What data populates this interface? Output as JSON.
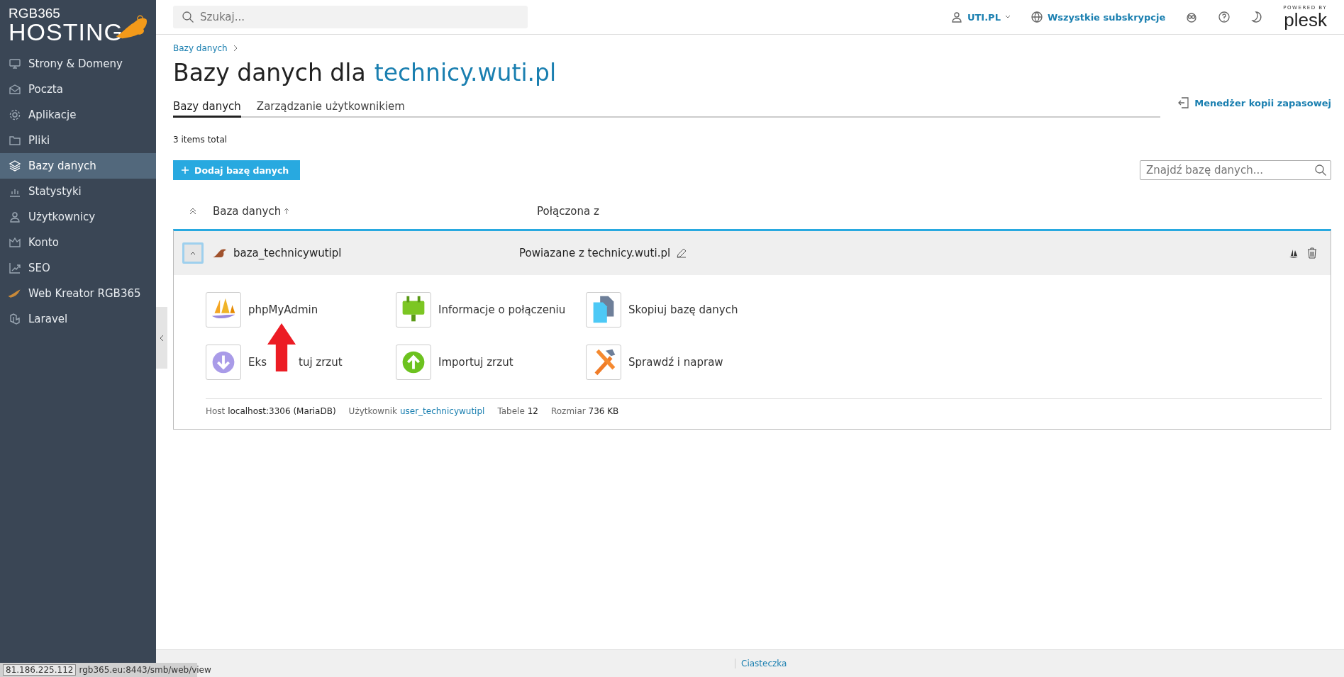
{
  "sidebar": {
    "logo": {
      "line1": "RGB365",
      "line2": "HOSTING"
    },
    "items": [
      {
        "label": "Strony & Domeny",
        "selected": false
      },
      {
        "label": "Poczta",
        "selected": false
      },
      {
        "label": "Aplikacje",
        "selected": false
      },
      {
        "label": "Pliki",
        "selected": false
      },
      {
        "label": "Bazy danych",
        "selected": true
      },
      {
        "label": "Statystyki",
        "selected": false
      },
      {
        "label": "Użytkownicy",
        "selected": false
      },
      {
        "label": "Konto",
        "selected": false
      },
      {
        "label": "SEO",
        "selected": false
      },
      {
        "label": "Web Kreator RGB365",
        "selected": false
      },
      {
        "label": "Laravel",
        "selected": false
      }
    ]
  },
  "topbar": {
    "search": {
      "placeholder": "Szukaj..."
    },
    "user": "UTI.PL",
    "subscriptions": "Wszystkie subskrypcje",
    "powered_by": "POWERED BY",
    "brand": "plesk"
  },
  "breadcrumb": [
    "Bazy danych"
  ],
  "title": {
    "text": "Bazy danych dla",
    "domain": "technicy.wuti.pl"
  },
  "tabs": [
    {
      "label": "Bazy danych",
      "selected": true
    },
    {
      "label": "Zarządzanie użytkownikiem",
      "selected": false
    }
  ],
  "backup_link": "Menedżer kopii zapasowej",
  "items_total": "3 items total",
  "add_button": "Dodaj bazę danych",
  "filter": {
    "placeholder": "Znajdź bazę danych..."
  },
  "table": {
    "columns": [
      "Baza danych",
      "Połączona z"
    ],
    "rows": [
      {
        "name": "baza_technicywutipl",
        "linked": "Powiazane z technicy.wuti.pl",
        "expanded": true,
        "actions": [
          {
            "label": "phpMyAdmin"
          },
          {
            "label": "Informacje o połączeniu"
          },
          {
            "label": "Skopiuj bazę danych"
          },
          {
            "label": "Eks",
            "label_end": "tuj zrzut"
          },
          {
            "label": "Importuj zrzut"
          },
          {
            "label": "Sprawdź i napraw"
          }
        ],
        "info": [
          {
            "label": "Host",
            "value": "localhost:3306 (MariaDB)",
            "kind": "text"
          },
          {
            "label": "Użytkownik",
            "value": "user_technicywutipl",
            "kind": "link"
          },
          {
            "label": "Tabele",
            "value": "12",
            "kind": "text"
          },
          {
            "label": "Rozmiar",
            "value": "736 KB",
            "kind": "text"
          }
        ]
      }
    ]
  },
  "footer": {
    "link": "Ciasteczka"
  },
  "status": {
    "tooltip": "81.186.225.112",
    "url": "rgb365.eu:8443/smb/web/view"
  }
}
